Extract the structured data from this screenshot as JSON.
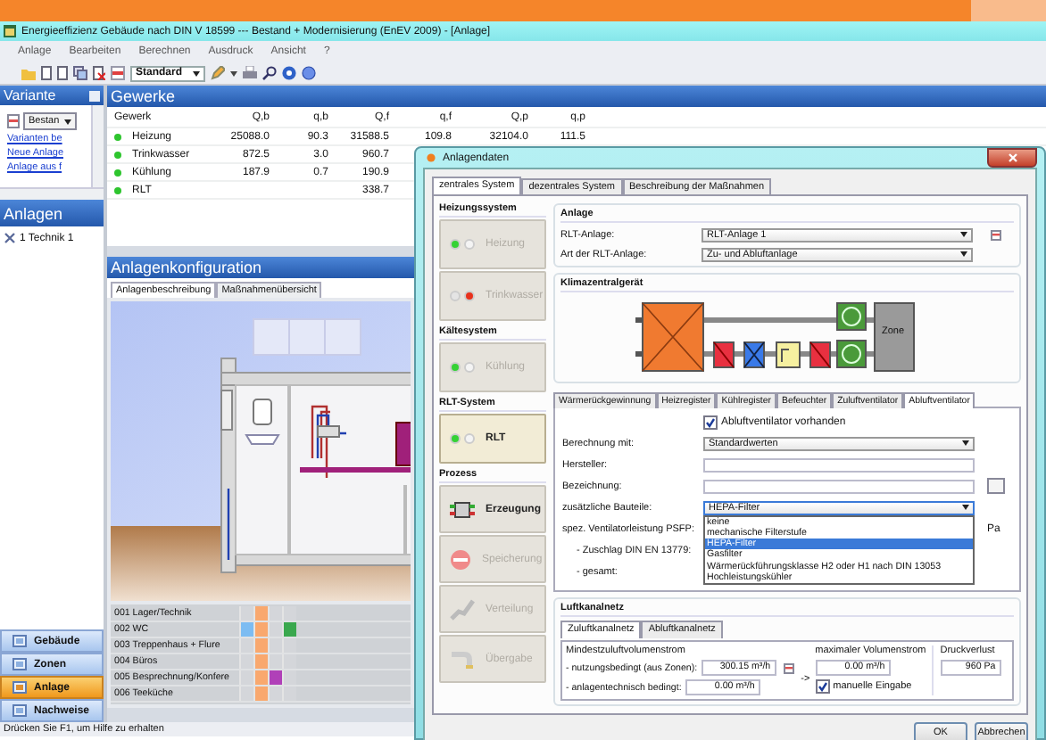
{
  "window": {
    "title": "Energieeffizienz Gebäude nach DIN V 18599 --- Bestand + Modernisierung (EnEV 2009) - [Anlage]"
  },
  "menu": [
    "Anlage",
    "Bearbeiten",
    "Berechnen",
    "Ausdruck",
    "Ansicht",
    "?"
  ],
  "toolbar": {
    "dropdown": "Standard"
  },
  "variante": {
    "title": "Variante",
    "dropdown": "Bestan",
    "links": [
      "Varianten be",
      "Neue Anlage",
      "Anlage aus f"
    ]
  },
  "anlagen": {
    "title": "Anlagen",
    "tree": [
      {
        "label": "1 Technik 1"
      }
    ]
  },
  "nav": [
    {
      "label": "Gebäude",
      "selected": false
    },
    {
      "label": "Zonen",
      "selected": false
    },
    {
      "label": "Anlage",
      "selected": true
    },
    {
      "label": "Nachweise",
      "selected": false
    }
  ],
  "gewerke": {
    "title": "Gewerke",
    "columns": [
      "Gewerk",
      "Q,b",
      "q,b",
      "Q,f",
      "q,f",
      "Q,p",
      "q,p"
    ],
    "rows": [
      {
        "color": "#2ec52e",
        "name": "Heizung",
        "Q_b": "25088.0",
        "q_b": "90.3",
        "Q_f": "31588.5",
        "q_f": "109.8",
        "Q_p": "32104.0",
        "q_p": "111.5"
      },
      {
        "color": "#2ec52e",
        "name": "Trinkwasser",
        "Q_b": "872.5",
        "q_b": "3.0",
        "Q_f": "960.7"
      },
      {
        "color": "#2ec52e",
        "name": "Kühlung",
        "Q_b": "187.9",
        "q_b": "0.7",
        "Q_f": "190.9"
      },
      {
        "color": "#2ec52e",
        "name": "RLT",
        "Q_f": "338.7"
      }
    ]
  },
  "anlagenkonfiguration": {
    "title": "Anlagenkonfiguration",
    "tabs": [
      {
        "label": "Anlagenbeschreibung",
        "selected": true
      },
      {
        "label": "Maßnahmenübersicht",
        "selected": false
      }
    ],
    "rooms": [
      {
        "name": "001 Lager/Technik",
        "cells": [
          {
            "color": "#d4d6da"
          },
          {
            "color": "#f9a86e"
          },
          {
            "color": "#d4d6da"
          },
          {
            "color": "#d4d6da"
          }
        ]
      },
      {
        "name": "002 WC",
        "cells": [
          {
            "color": "#7cbcf2"
          },
          {
            "color": "#f9a86e"
          },
          {
            "color": "#d4d6da"
          },
          {
            "color": "#3aa84e"
          }
        ]
      },
      {
        "name": "003 Treppenhaus + Flure",
        "cells": [
          {
            "color": "#d4d6da"
          },
          {
            "color": "#f9a86e"
          },
          {
            "color": "#d4d6da"
          },
          {
            "color": "#d4d6da"
          }
        ]
      },
      {
        "name": "004 Büros",
        "cells": [
          {
            "color": "#d4d6da"
          },
          {
            "color": "#f9a86e"
          },
          {
            "color": "#d4d6da"
          },
          {
            "color": "#d4d6da"
          }
        ]
      },
      {
        "name": "005 Besprechnung/Konfere",
        "cells": [
          {
            "color": "#d4d6da"
          },
          {
            "color": "#f9a86e"
          },
          {
            "color": "#b040b8"
          },
          {
            "color": "#d4d6da"
          }
        ]
      },
      {
        "name": "006 Teeküche",
        "cells": [
          {
            "color": "#d4d6da"
          },
          {
            "color": "#f9a86e"
          },
          {
            "color": "#d4d6da"
          },
          {
            "color": "#d4d6da"
          }
        ]
      }
    ]
  },
  "status_bar": "Drücken Sie F1, um Hilfe zu erhalten",
  "dialog": {
    "title": "Anlagendaten",
    "tabs": [
      {
        "label": "zentrales System",
        "selected": true
      },
      {
        "label": "dezentrales System",
        "selected": false
      },
      {
        "label": "Beschreibung der Maßnahmen",
        "selected": false
      }
    ],
    "systems": [
      {
        "title": "Heizungssystem",
        "buttons": [
          {
            "kind": "light",
            "label": "Heizung",
            "fault": false,
            "disabled": true,
            "selected": false
          },
          {
            "kind": "light",
            "label": "Trinkwasser",
            "fault": true,
            "disabled": true,
            "selected": false
          }
        ]
      },
      {
        "title": "Kältesystem",
        "buttons": [
          {
            "kind": "light",
            "label": "Kühlung",
            "fault": false,
            "disabled": true,
            "selected": false
          }
        ]
      },
      {
        "title": "RLT-System",
        "buttons": [
          {
            "kind": "light",
            "label": "RLT",
            "fault": false,
            "disabled": false,
            "selected": true
          }
        ]
      },
      {
        "title": "Prozess",
        "buttons": [
          {
            "kind": "process",
            "label": "Erzeugung",
            "disabled": false,
            "selected": false
          },
          {
            "kind": "process",
            "label": "Speicherung",
            "disabled": true,
            "selected": false
          },
          {
            "kind": "process",
            "label": "Verteilung",
            "disabled": true,
            "selected": false
          },
          {
            "kind": "process",
            "label": "Übergabe",
            "disabled": true,
            "selected": false
          }
        ]
      }
    ],
    "anlage": {
      "title": "Anlage",
      "fields": [
        {
          "label": "RLT-Anlage:",
          "value": "RLT-Anlage 1",
          "button": true
        },
        {
          "label": "Art der RLT-Anlage:",
          "value": "Zu- und Abluftanlage",
          "button": false
        }
      ]
    },
    "klimazentralgeraet": {
      "title": "Klimazentralgerät",
      "zone_label": "Zone"
    },
    "component_tabs": [
      {
        "label": "Wärmerückgewinnung",
        "selected": false
      },
      {
        "label": "Heizregister",
        "selected": false
      },
      {
        "label": "Kühlregister",
        "selected": false
      },
      {
        "label": "Befeuchter",
        "selected": false
      },
      {
        "label": "Zuluftventilator",
        "selected": false
      },
      {
        "label": "Abluftventilator",
        "selected": true
      }
    ],
    "abluftventilator": {
      "present": {
        "label": "Abluftventilator vorhanden",
        "checked": true
      },
      "fields": [
        {
          "kind": "select",
          "label": "Berechnung mit:",
          "value": "Standardwerten",
          "expanded": false
        },
        {
          "kind": "input",
          "label": "Hersteller:",
          "button": false
        },
        {
          "kind": "input",
          "label": "Bezeichnung:",
          "button": true
        },
        {
          "kind": "select",
          "label": "zusätzliche Bauteile:",
          "value": "HEPA-Filter",
          "expanded": true,
          "options": [
            {
              "label": "keine",
              "selected": false
            },
            {
              "label": "mechanische Filterstufe",
              "selected": false
            },
            {
              "label": "HEPA-Filter",
              "selected": true
            },
            {
              "label": "Gasfilter",
              "selected": false
            },
            {
              "label": "Wärmerückführungsklasse H2 oder H1 nach DIN 13053",
              "selected": false
            },
            {
              "label": "Hochleistungskühler",
              "selected": false
            }
          ]
        },
        {
          "kind": "readout",
          "label": "spez. Ventilatorleistung PSFP:",
          "unit": "Pa"
        },
        {
          "kind": "readout",
          "label": "- Zuschlag DIN EN 13779:"
        },
        {
          "kind": "readout",
          "label": "- gesamt:"
        }
      ]
    },
    "luftkanalnetz": {
      "title": "Luftkanalnetz",
      "tabs": [
        {
          "label": "Zuluftkanalnetz",
          "selected": true
        },
        {
          "label": "Abluftkanalnetz",
          "selected": false
        }
      ],
      "min_title": "Mindestzuluftvolumenstrom",
      "min_rows": [
        {
          "label": "- nutzungsbedingt (aus Zonen):",
          "value": "300.15 m³/h",
          "button": true
        },
        {
          "label": "- anlagentechnisch bedingt:",
          "value": "0.00 m³/h",
          "button": false
        }
      ],
      "arrow": "->",
      "max_title": "maximaler Volumenstrom",
      "max_value": "0.00 m³/h",
      "manual": {
        "label": "manuelle Eingabe",
        "checked": true
      },
      "pressure_title": "Druckverlust",
      "pressure_value": "960 Pa"
    },
    "buttons": [
      "OK",
      "Abbrechen"
    ]
  }
}
